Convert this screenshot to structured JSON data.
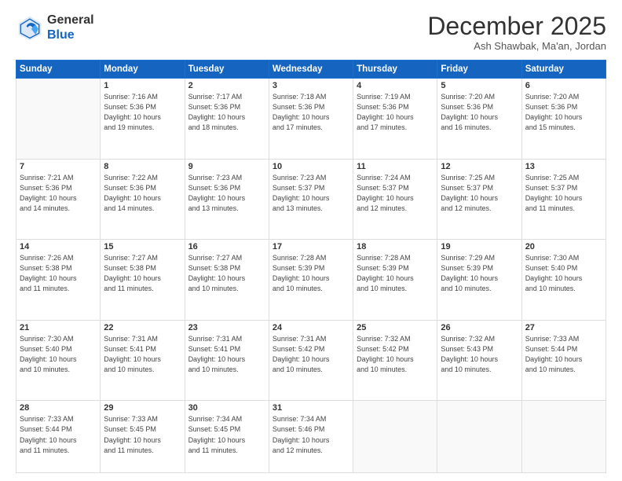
{
  "header": {
    "logo_line1": "General",
    "logo_line2": "Blue",
    "month": "December 2025",
    "location": "Ash Shawbak, Ma'an, Jordan"
  },
  "days_of_week": [
    "Sunday",
    "Monday",
    "Tuesday",
    "Wednesday",
    "Thursday",
    "Friday",
    "Saturday"
  ],
  "weeks": [
    [
      {
        "num": "",
        "info": ""
      },
      {
        "num": "1",
        "info": "Sunrise: 7:16 AM\nSunset: 5:36 PM\nDaylight: 10 hours\nand 19 minutes."
      },
      {
        "num": "2",
        "info": "Sunrise: 7:17 AM\nSunset: 5:36 PM\nDaylight: 10 hours\nand 18 minutes."
      },
      {
        "num": "3",
        "info": "Sunrise: 7:18 AM\nSunset: 5:36 PM\nDaylight: 10 hours\nand 17 minutes."
      },
      {
        "num": "4",
        "info": "Sunrise: 7:19 AM\nSunset: 5:36 PM\nDaylight: 10 hours\nand 17 minutes."
      },
      {
        "num": "5",
        "info": "Sunrise: 7:20 AM\nSunset: 5:36 PM\nDaylight: 10 hours\nand 16 minutes."
      },
      {
        "num": "6",
        "info": "Sunrise: 7:20 AM\nSunset: 5:36 PM\nDaylight: 10 hours\nand 15 minutes."
      }
    ],
    [
      {
        "num": "7",
        "info": "Sunrise: 7:21 AM\nSunset: 5:36 PM\nDaylight: 10 hours\nand 14 minutes."
      },
      {
        "num": "8",
        "info": "Sunrise: 7:22 AM\nSunset: 5:36 PM\nDaylight: 10 hours\nand 14 minutes."
      },
      {
        "num": "9",
        "info": "Sunrise: 7:23 AM\nSunset: 5:36 PM\nDaylight: 10 hours\nand 13 minutes."
      },
      {
        "num": "10",
        "info": "Sunrise: 7:23 AM\nSunset: 5:37 PM\nDaylight: 10 hours\nand 13 minutes."
      },
      {
        "num": "11",
        "info": "Sunrise: 7:24 AM\nSunset: 5:37 PM\nDaylight: 10 hours\nand 12 minutes."
      },
      {
        "num": "12",
        "info": "Sunrise: 7:25 AM\nSunset: 5:37 PM\nDaylight: 10 hours\nand 12 minutes."
      },
      {
        "num": "13",
        "info": "Sunrise: 7:25 AM\nSunset: 5:37 PM\nDaylight: 10 hours\nand 11 minutes."
      }
    ],
    [
      {
        "num": "14",
        "info": "Sunrise: 7:26 AM\nSunset: 5:38 PM\nDaylight: 10 hours\nand 11 minutes."
      },
      {
        "num": "15",
        "info": "Sunrise: 7:27 AM\nSunset: 5:38 PM\nDaylight: 10 hours\nand 11 minutes."
      },
      {
        "num": "16",
        "info": "Sunrise: 7:27 AM\nSunset: 5:38 PM\nDaylight: 10 hours\nand 10 minutes."
      },
      {
        "num": "17",
        "info": "Sunrise: 7:28 AM\nSunset: 5:39 PM\nDaylight: 10 hours\nand 10 minutes."
      },
      {
        "num": "18",
        "info": "Sunrise: 7:28 AM\nSunset: 5:39 PM\nDaylight: 10 hours\nand 10 minutes."
      },
      {
        "num": "19",
        "info": "Sunrise: 7:29 AM\nSunset: 5:39 PM\nDaylight: 10 hours\nand 10 minutes."
      },
      {
        "num": "20",
        "info": "Sunrise: 7:30 AM\nSunset: 5:40 PM\nDaylight: 10 hours\nand 10 minutes."
      }
    ],
    [
      {
        "num": "21",
        "info": "Sunrise: 7:30 AM\nSunset: 5:40 PM\nDaylight: 10 hours\nand 10 minutes."
      },
      {
        "num": "22",
        "info": "Sunrise: 7:31 AM\nSunset: 5:41 PM\nDaylight: 10 hours\nand 10 minutes."
      },
      {
        "num": "23",
        "info": "Sunrise: 7:31 AM\nSunset: 5:41 PM\nDaylight: 10 hours\nand 10 minutes."
      },
      {
        "num": "24",
        "info": "Sunrise: 7:31 AM\nSunset: 5:42 PM\nDaylight: 10 hours\nand 10 minutes."
      },
      {
        "num": "25",
        "info": "Sunrise: 7:32 AM\nSunset: 5:42 PM\nDaylight: 10 hours\nand 10 minutes."
      },
      {
        "num": "26",
        "info": "Sunrise: 7:32 AM\nSunset: 5:43 PM\nDaylight: 10 hours\nand 10 minutes."
      },
      {
        "num": "27",
        "info": "Sunrise: 7:33 AM\nSunset: 5:44 PM\nDaylight: 10 hours\nand 10 minutes."
      }
    ],
    [
      {
        "num": "28",
        "info": "Sunrise: 7:33 AM\nSunset: 5:44 PM\nDaylight: 10 hours\nand 11 minutes."
      },
      {
        "num": "29",
        "info": "Sunrise: 7:33 AM\nSunset: 5:45 PM\nDaylight: 10 hours\nand 11 minutes."
      },
      {
        "num": "30",
        "info": "Sunrise: 7:34 AM\nSunset: 5:45 PM\nDaylight: 10 hours\nand 11 minutes."
      },
      {
        "num": "31",
        "info": "Sunrise: 7:34 AM\nSunset: 5:46 PM\nDaylight: 10 hours\nand 12 minutes."
      },
      {
        "num": "",
        "info": ""
      },
      {
        "num": "",
        "info": ""
      },
      {
        "num": "",
        "info": ""
      }
    ]
  ]
}
